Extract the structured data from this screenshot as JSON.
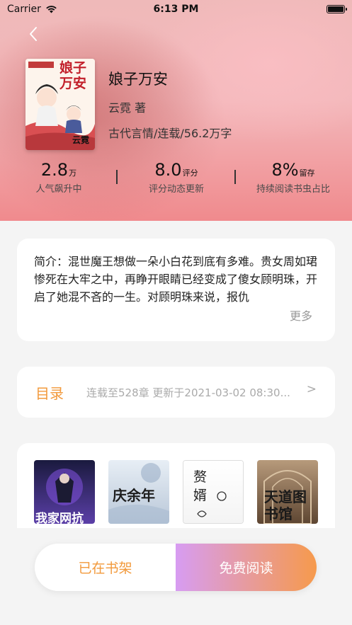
{
  "status": {
    "carrier": "Carrier",
    "time": "6:13 PM",
    "battery_level": 1.0
  },
  "book": {
    "title": "娘子万安",
    "author": "云霓 著",
    "meta": "古代言情/连载/56.2万字",
    "cover_title_text": "娘子万安",
    "cover_author_text": "云霓"
  },
  "stats": [
    {
      "value": "2.8",
      "unit": "万",
      "label": "人气飙升中"
    },
    {
      "value": "8.0",
      "unit": "评分",
      "label": "评分动态更新"
    },
    {
      "value": "8%",
      "unit": "留存",
      "label": "持续阅读书虫占比"
    }
  ],
  "intro": {
    "text": "简介：混世魔王想做一朵小白花到底有多难。贵女周如珺惨死在大牢之中，再睁开眼睛已经变成了傻女顾明珠，开启了她混不吝的一生。对顾明珠来说，报仇",
    "more_label": "更多"
  },
  "catalog": {
    "label": "目录",
    "info": "连载至528章 更新于2021-03-02 08:30...",
    "arrow": ">"
  },
  "recommendations": [
    {
      "name": "rec-book-1",
      "color_top": "#1a1a3e",
      "color_bottom": "#5b3fa8",
      "text": "我家网抗"
    },
    {
      "name": "rec-book-2",
      "color_top": "#e7eef5",
      "color_bottom": "#b9c7d8",
      "text": "庆余年"
    },
    {
      "name": "rec-book-3",
      "color_top": "#ffffff",
      "color_bottom": "#f4f4f4",
      "text": "赘婿"
    },
    {
      "name": "rec-book-4",
      "color_top": "#b79a7b",
      "color_bottom": "#5e4632",
      "text": "天道图书馆"
    }
  ],
  "actions": {
    "shelf_label": "已在书架",
    "read_label": "免费阅读"
  },
  "colors": {
    "accent": "#f2993b",
    "read_gradient_start": "#d79cf2",
    "read_gradient_end": "#f69a4c"
  }
}
